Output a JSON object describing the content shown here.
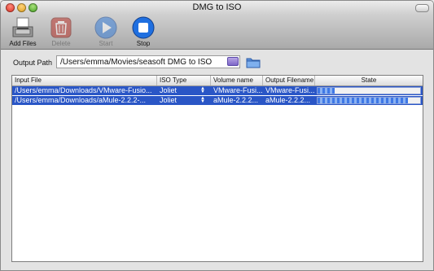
{
  "window": {
    "title": "DMG to ISO"
  },
  "toolbar": {
    "add_files": "Add Files",
    "delete": "Delete",
    "start": "Start",
    "stop": "Stop"
  },
  "output": {
    "label": "Output Path",
    "path": "/Users/emma/Movies/seasoft DMG to ISO"
  },
  "table": {
    "columns": [
      "Input File",
      "ISO Type",
      "Volume name",
      "Output Filename",
      "State"
    ],
    "rows": [
      {
        "input_file": "/Users/emma/Downloads/VMware-Fusio...",
        "iso_type": "Joliet",
        "volume_name": "VMware-Fusi...",
        "output_filename": "VMware-Fusi...",
        "progress": 0.17
      },
      {
        "input_file": "/Users/emma/Downloads/aMule-2.2.2-...",
        "iso_type": "Joliet",
        "volume_name": "aMule-2.2.2...",
        "output_filename": "aMule-2.2.2...",
        "progress": 0.88
      }
    ]
  },
  "colors": {
    "selection": "#2a56c6",
    "start_icon": "#3a7fd8",
    "stop_icon": "#1f6fe0",
    "delete_icon": "#b8322a"
  },
  "icons": [
    "add-files-icon",
    "delete-icon",
    "start-icon",
    "stop-icon",
    "browse-icon",
    "folder-icon"
  ]
}
